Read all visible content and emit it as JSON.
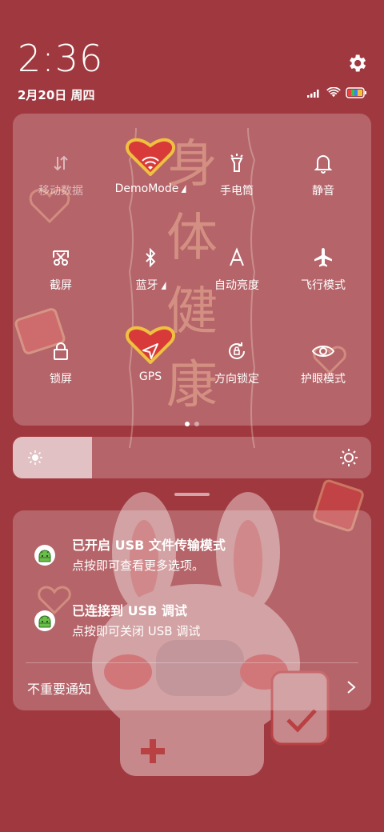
{
  "status_bar": {
    "time": "2:36",
    "date": "2月20日 周四"
  },
  "wallpaper": {
    "text_lines": [
      "身",
      "体",
      "健",
      "康"
    ]
  },
  "quick_settings": {
    "tiles": [
      {
        "label": "移动数据",
        "icon": "mobile-data-icon",
        "active": false
      },
      {
        "label": "DemoMode",
        "icon": "wifi-icon",
        "active": true
      },
      {
        "label": "手电筒",
        "icon": "flashlight-icon",
        "active": true
      },
      {
        "label": "静音",
        "icon": "bell-icon",
        "active": true
      },
      {
        "label": "截屏",
        "icon": "screenshot-icon",
        "active": true
      },
      {
        "label": "蓝牙",
        "icon": "bluetooth-icon",
        "active": true
      },
      {
        "label": "自动亮度",
        "icon": "auto-brightness-icon",
        "active": true
      },
      {
        "label": "飞行模式",
        "icon": "airplane-icon",
        "active": true
      },
      {
        "label": "锁屏",
        "icon": "lock-icon",
        "active": true
      },
      {
        "label": "GPS",
        "icon": "location-icon",
        "active": true
      },
      {
        "label": "方向锁定",
        "icon": "rotation-lock-icon",
        "active": true
      },
      {
        "label": "护眼模式",
        "icon": "eye-icon",
        "active": true
      }
    ],
    "page_count": 2,
    "current_page": 1
  },
  "brightness": {
    "level": 0.22
  },
  "notifications": {
    "items": [
      {
        "title": "已开启 USB 文件传输模式",
        "subtitle": "点按即可查看更多选项。",
        "icon": "android-icon"
      },
      {
        "title": "已连接到 USB 调试",
        "subtitle": "点按即可关闭 USB 调试",
        "icon": "android-icon"
      }
    ],
    "footer_label": "不重要通知"
  },
  "colors": {
    "background": "#a0393f",
    "accent_heart": "#d83a3a",
    "heart_border": "#f0c040"
  }
}
